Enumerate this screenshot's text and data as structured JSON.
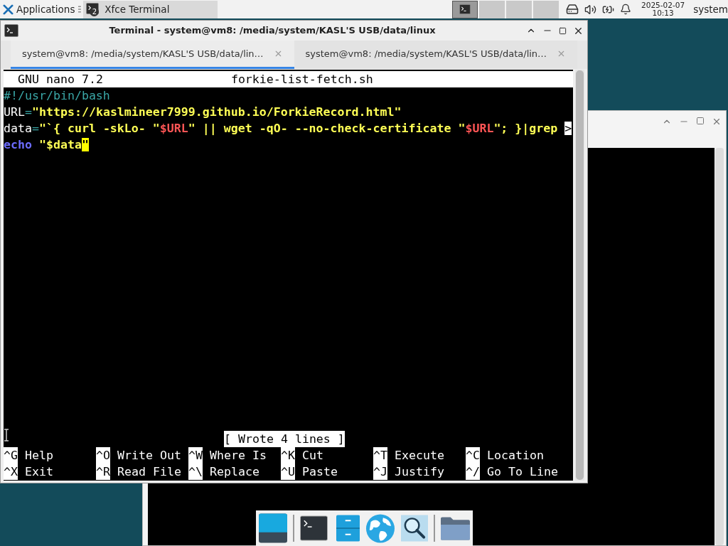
{
  "panel": {
    "applications_label": "Applications",
    "tasks": [
      {
        "label": "Xfce Terminal",
        "count": "2",
        "selected": true
      }
    ],
    "workspaces": [
      {
        "selected": true
      },
      {
        "selected": false
      },
      {
        "selected": false
      },
      {
        "selected": false
      }
    ],
    "clock": {
      "date": "2025-02-07",
      "time": "10:13"
    },
    "user": "system"
  },
  "terminal": {
    "title": "Terminal - system@vm8: /media/system/KASL'S USB/data/linux",
    "tabs": [
      {
        "label": "system@vm8: /media/system/KASL'S USB/data/lin…",
        "selected": true
      },
      {
        "label": "system@vm8: /media/system/KASL'S USB/data/lin…",
        "selected": false
      }
    ],
    "nano": {
      "version": "GNU nano 7.2",
      "filename": "forkie-list-fetch.sh",
      "lines": [
        [
          {
            "text": "#!/usr/bin/bash",
            "kind": "comment"
          }
        ],
        [
          {
            "text": "URL",
            "kind": "plain"
          },
          {
            "text": "=",
            "kind": "op"
          },
          {
            "text": "\"https://kaslmineer7999.github.io/ForkieRecord.html\"",
            "kind": "string"
          }
        ],
        [
          {
            "text": "data",
            "kind": "plain"
          },
          {
            "text": "=",
            "kind": "op"
          },
          {
            "text": "\"`{ curl -skLo- \"",
            "kind": "string"
          },
          {
            "text": "$URL",
            "kind": "var"
          },
          {
            "text": "\" || wget -qO- --no-check-certificate \"",
            "kind": "string"
          },
          {
            "text": "$URL",
            "kind": "var"
          },
          {
            "text": "\"; }|grep ",
            "kind": "string"
          },
          {
            "text": ">",
            "kind": "overflow"
          }
        ],
        [
          {
            "text": "echo",
            "kind": "builtin"
          },
          {
            "text": " \"$data",
            "kind": "string"
          },
          {
            "text": "\"",
            "kind": "cursor"
          }
        ]
      ],
      "status": "[ Wrote 4 lines ]",
      "shortcut_rows": [
        [
          {
            "key": "^G",
            "label": "Help"
          },
          {
            "key": "^O",
            "label": "Write Out"
          },
          {
            "key": "^W",
            "label": "Where Is"
          },
          {
            "key": "^K",
            "label": "Cut"
          },
          {
            "key": "^T",
            "label": "Execute"
          },
          {
            "key": "^C",
            "label": "Location"
          }
        ],
        [
          {
            "key": "^X",
            "label": "Exit"
          },
          {
            "key": "^R",
            "label": "Read File"
          },
          {
            "key": "^\\",
            "label": "Replace"
          },
          {
            "key": "^U",
            "label": "Paste"
          },
          {
            "key": "^J",
            "label": "Justify"
          },
          {
            "key": "^/",
            "label": "Go To Line"
          }
        ]
      ]
    }
  }
}
